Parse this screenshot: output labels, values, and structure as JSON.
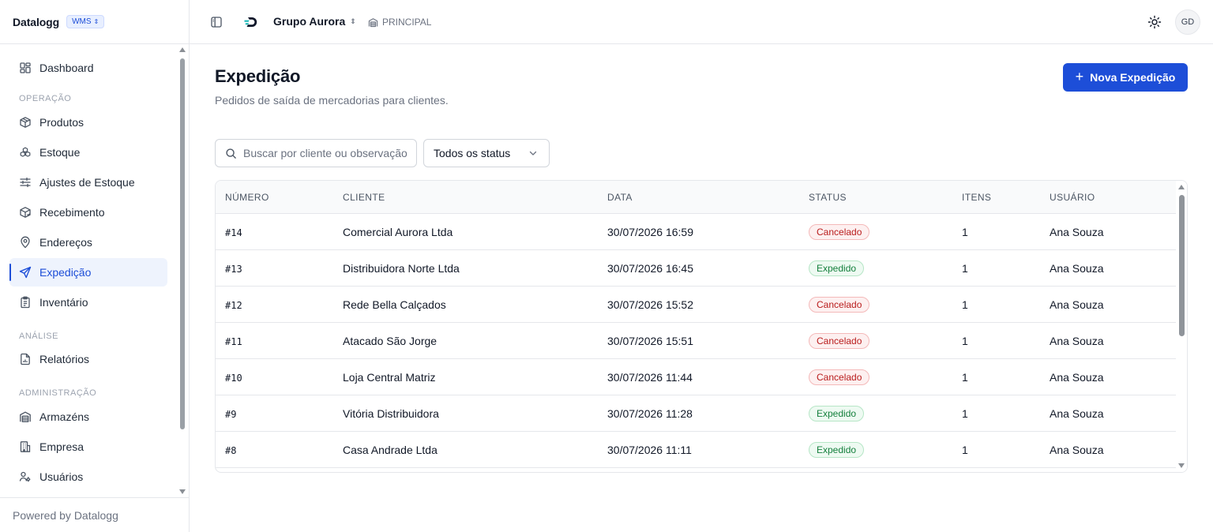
{
  "sidebar": {
    "brand": "Datalogg",
    "module_badge": "WMS",
    "items": [
      {
        "label": "Dashboard",
        "icon": "dashboard-grid-icon"
      },
      {
        "label": "Produtos",
        "icon": "package-icon"
      },
      {
        "label": "Estoque",
        "icon": "boxes-icon"
      },
      {
        "label": "Ajustes de Estoque",
        "icon": "sliders-icon"
      },
      {
        "label": "Recebimento",
        "icon": "package-receive-icon"
      },
      {
        "label": "Endereços",
        "icon": "map-pin-icon"
      },
      {
        "label": "Expedição",
        "icon": "send-icon",
        "active": true
      },
      {
        "label": "Inventário",
        "icon": "clipboard-list-icon"
      },
      {
        "label": "Relatórios",
        "icon": "file-chart-icon"
      },
      {
        "label": "Armazéns",
        "icon": "warehouse-icon"
      },
      {
        "label": "Empresa",
        "icon": "building-icon"
      },
      {
        "label": "Usuários",
        "icon": "users-icon"
      }
    ],
    "sections": {
      "operacao": "OPERAÇÃO",
      "analise": "ANÁLISE",
      "administracao": "ADMINISTRAÇÃO"
    },
    "footer": "Powered by Datalogg"
  },
  "topbar": {
    "company": "Grupo Aurora",
    "warehouse": "PRINCIPAL",
    "avatar_initials": "GD"
  },
  "page": {
    "title": "Expedição",
    "subtitle": "Pedidos de saída de mercadorias para clientes.",
    "new_button": "Nova Expedição"
  },
  "filters": {
    "search_placeholder": "Buscar por cliente ou observação",
    "status_select": "Todos os status"
  },
  "table": {
    "columns": [
      "NÚMERO",
      "CLIENTE",
      "DATA",
      "STATUS",
      "ITENS",
      "USUÁRIO"
    ],
    "rows": [
      {
        "numero": "#14",
        "cliente": "Comercial Aurora Ltda",
        "data": "30/07/2026 16:59",
        "status": "Cancelado",
        "itens": "1",
        "usuario": "Ana Souza"
      },
      {
        "numero": "#13",
        "cliente": "Distribuidora Norte Ltda",
        "data": "30/07/2026 16:45",
        "status": "Expedido",
        "itens": "1",
        "usuario": "Ana Souza"
      },
      {
        "numero": "#12",
        "cliente": "Rede Bella Calçados",
        "data": "30/07/2026 15:52",
        "status": "Cancelado",
        "itens": "1",
        "usuario": "Ana Souza"
      },
      {
        "numero": "#11",
        "cliente": "Atacado São Jorge",
        "data": "30/07/2026 15:51",
        "status": "Cancelado",
        "itens": "1",
        "usuario": "Ana Souza"
      },
      {
        "numero": "#10",
        "cliente": "Loja Central Matriz",
        "data": "30/07/2026 11:44",
        "status": "Cancelado",
        "itens": "1",
        "usuario": "Ana Souza"
      },
      {
        "numero": "#9",
        "cliente": "Vitória Distribuidora",
        "data": "30/07/2026 11:28",
        "status": "Expedido",
        "itens": "1",
        "usuario": "Ana Souza"
      },
      {
        "numero": "#8",
        "cliente": "Casa Andrade Ltda",
        "data": "30/07/2026 11:11",
        "status": "Expedido",
        "itens": "1",
        "usuario": "Ana Souza"
      }
    ]
  },
  "colors": {
    "accent": "#1d4ed8",
    "cancelado": "#b91c1c",
    "expedido": "#15803d"
  }
}
